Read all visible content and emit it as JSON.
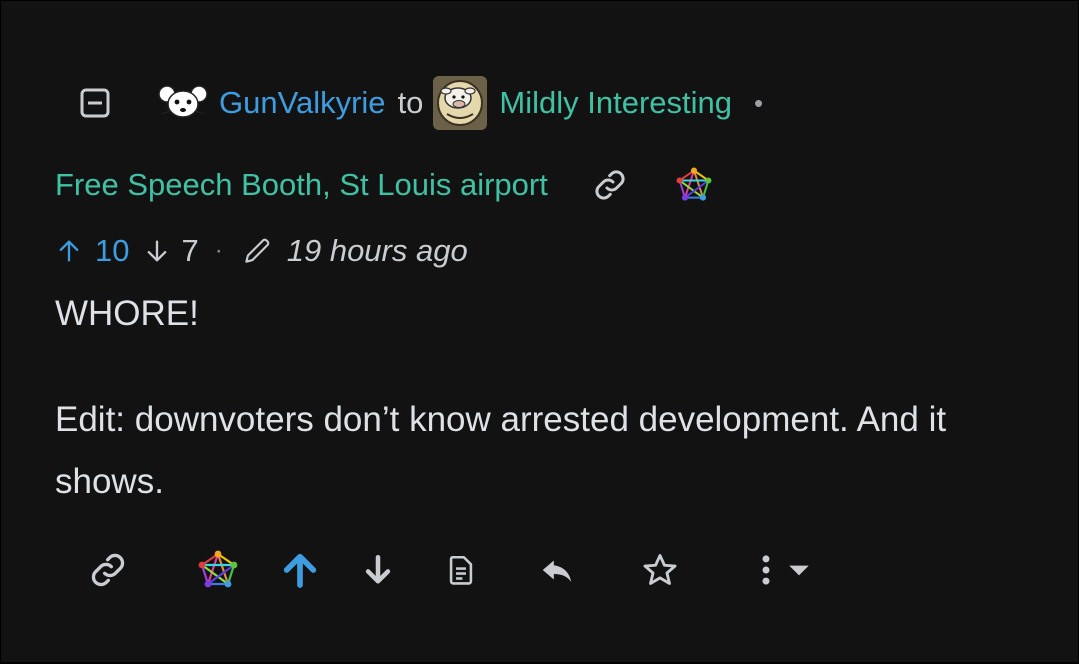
{
  "comment": {
    "author": "GunValkyrie",
    "connector": "to",
    "community": "Mildly Interesting",
    "separator": "•",
    "post_title": "Free Speech Booth, St Louis airport",
    "upvotes": "10",
    "downvotes": "7",
    "meta_separator": "·",
    "timestamp": "19 hours ago",
    "body": [
      "WHORE!",
      "Edit: downvoters don’t know arrested development. And it shows."
    ]
  },
  "icons": {
    "collapse": "collapse-minus-icon",
    "author_avatar": "mouse-avatar-icon",
    "community_avatar": "cow-avatar-icon",
    "post_link": "link-icon",
    "fediverse": "fediverse-icon",
    "upvote": "arrow-up-icon",
    "downvote": "arrow-down-icon",
    "edited": "pencil-icon",
    "actions": [
      "link-icon",
      "fediverse-icon",
      "upvote-arrow-icon",
      "downvote-arrow-icon",
      "view-source-icon",
      "reply-icon",
      "star-icon",
      "more-vertical-icon",
      "caret-down-icon"
    ]
  },
  "colors": {
    "background": "#121212",
    "link_blue": "#3d9de0",
    "community_teal": "#3fc1a4",
    "text": "#dee2e6",
    "muted": "#9aa0a6",
    "action_icon": "#c9ccd0"
  }
}
